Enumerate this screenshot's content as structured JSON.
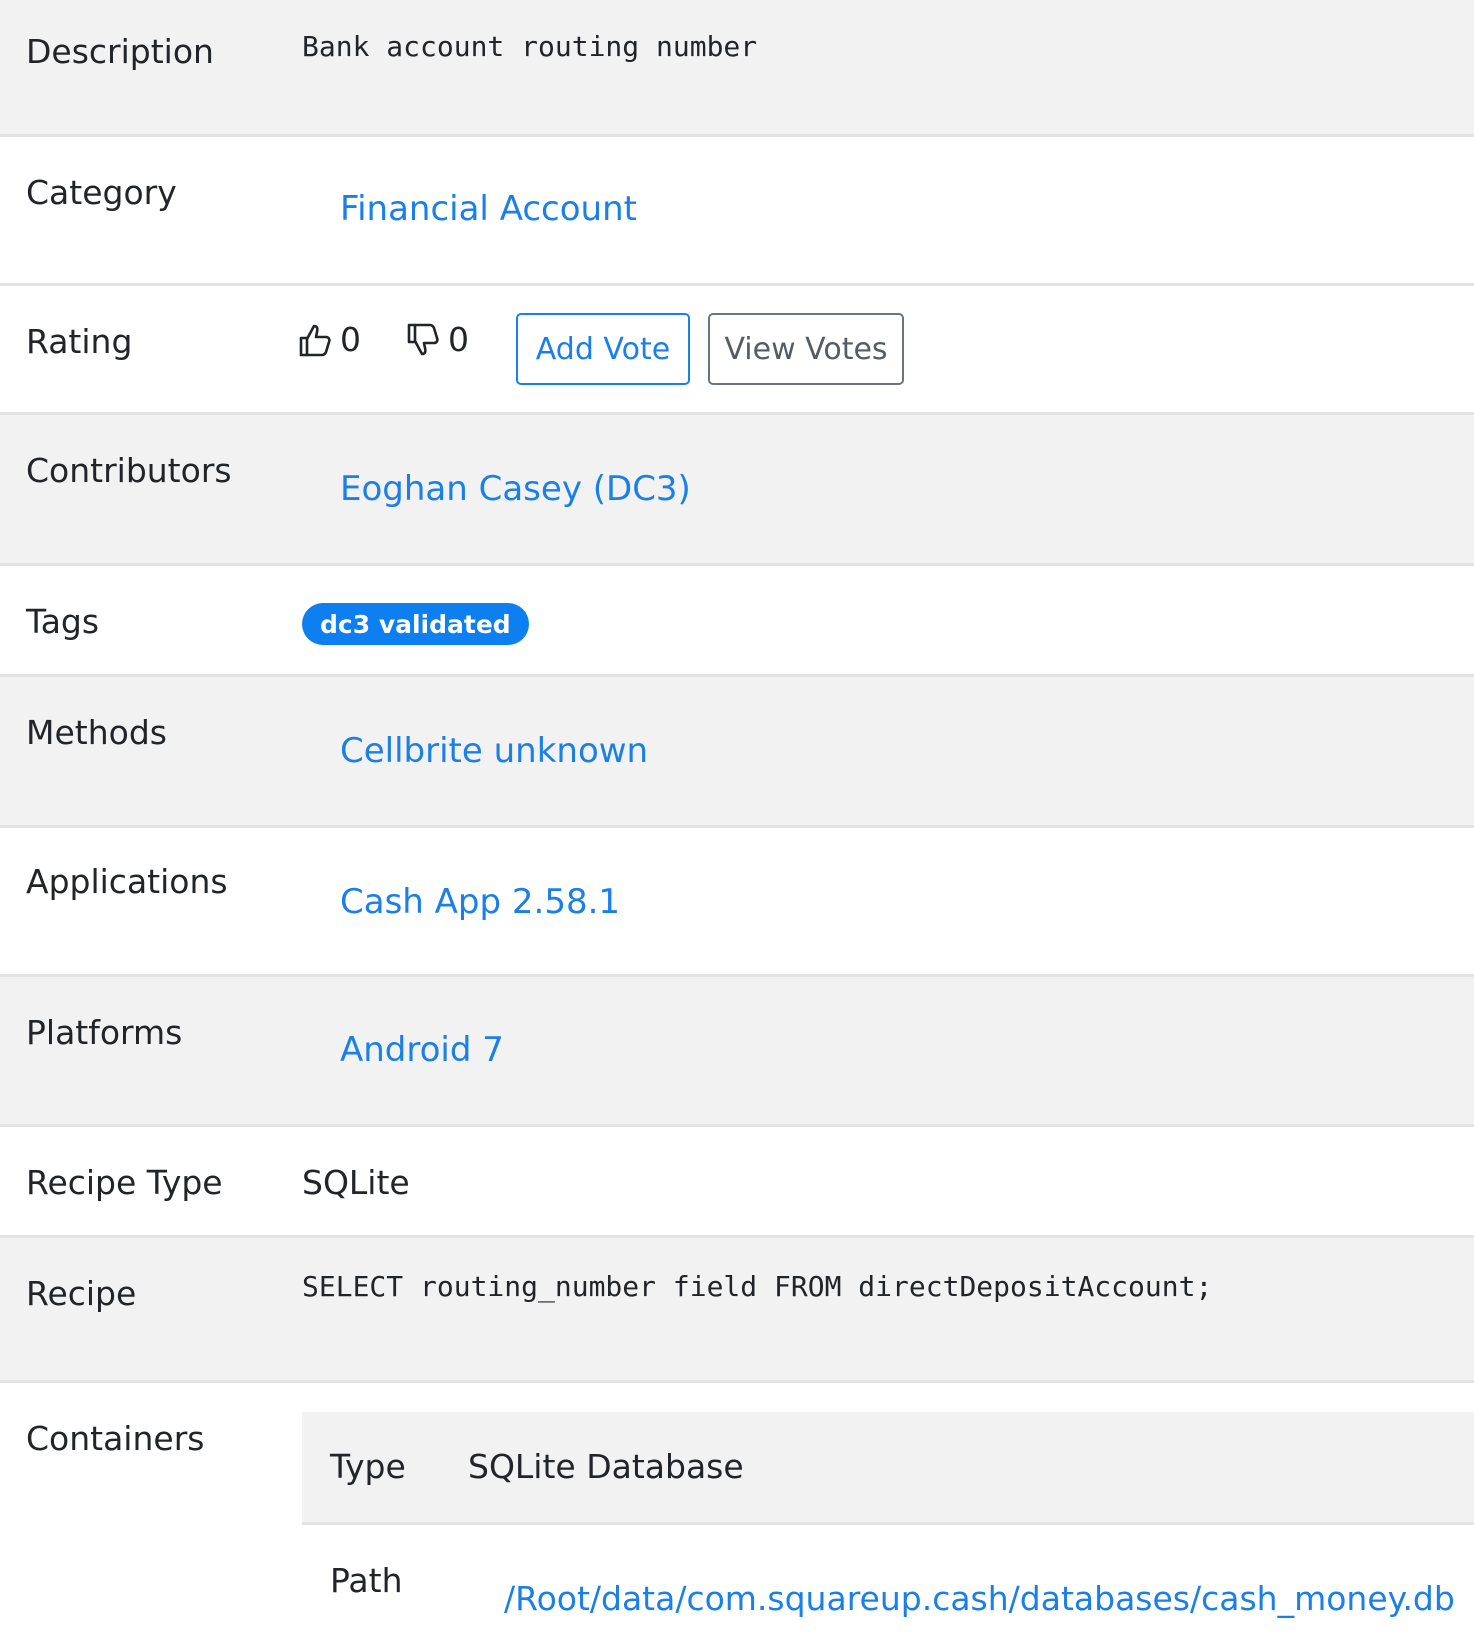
{
  "rows": {
    "description": {
      "label": "Description",
      "value": "Bank account routing number"
    },
    "category": {
      "label": "Category",
      "value": "Financial Account"
    },
    "rating": {
      "label": "Rating",
      "upvotes": "0",
      "downvotes": "0",
      "add_vote_label": "Add Vote",
      "view_votes_label": "View Votes"
    },
    "contributors": {
      "label": "Contributors",
      "value": "Eoghan Casey (DC3)"
    },
    "tags": {
      "label": "Tags",
      "badge": "dc3 validated"
    },
    "methods": {
      "label": "Methods",
      "value": "Cellbrite unknown"
    },
    "applications": {
      "label": "Applications",
      "value": "Cash App 2.58.1"
    },
    "platforms": {
      "label": "Platforms",
      "value": "Android 7"
    },
    "recipe_type": {
      "label": "Recipe Type",
      "value": "SQLite"
    },
    "recipe": {
      "label": "Recipe",
      "value": "SELECT routing_number field FROM directDepositAccount;"
    },
    "containers": {
      "label": "Containers",
      "type_label": "Type",
      "type_value": "SQLite Database",
      "path_label": "Path",
      "path_value": "/Root/data/com.squareup.cash/databases/cash_money.db"
    }
  },
  "colors": {
    "link": "#1a7fe8",
    "badge_bg": "#0d7ff0",
    "row_shade": "#f2f2f2",
    "divider": "#e3e3e3"
  },
  "icons": {
    "upvote": "thumbs-up-icon",
    "downvote": "thumbs-down-icon"
  }
}
